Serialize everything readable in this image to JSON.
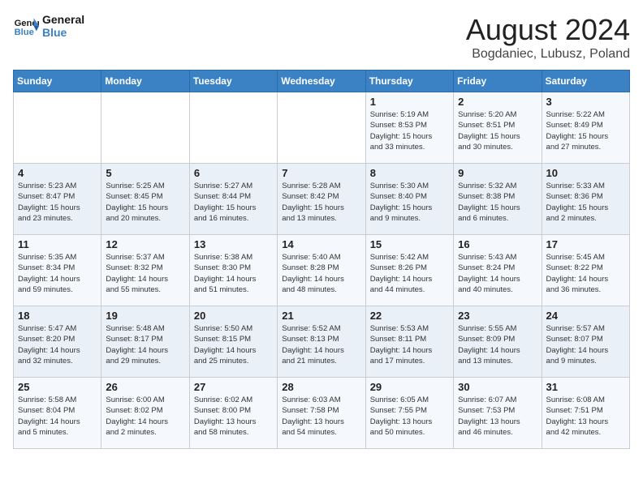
{
  "header": {
    "logo_line1": "General",
    "logo_line2": "Blue",
    "month": "August 2024",
    "location": "Bogdaniec, Lubusz, Poland"
  },
  "weekdays": [
    "Sunday",
    "Monday",
    "Tuesday",
    "Wednesday",
    "Thursday",
    "Friday",
    "Saturday"
  ],
  "weeks": [
    [
      {
        "day": "",
        "detail": ""
      },
      {
        "day": "",
        "detail": ""
      },
      {
        "day": "",
        "detail": ""
      },
      {
        "day": "",
        "detail": ""
      },
      {
        "day": "1",
        "detail": "Sunrise: 5:19 AM\nSunset: 8:53 PM\nDaylight: 15 hours\nand 33 minutes."
      },
      {
        "day": "2",
        "detail": "Sunrise: 5:20 AM\nSunset: 8:51 PM\nDaylight: 15 hours\nand 30 minutes."
      },
      {
        "day": "3",
        "detail": "Sunrise: 5:22 AM\nSunset: 8:49 PM\nDaylight: 15 hours\nand 27 minutes."
      }
    ],
    [
      {
        "day": "4",
        "detail": "Sunrise: 5:23 AM\nSunset: 8:47 PM\nDaylight: 15 hours\nand 23 minutes."
      },
      {
        "day": "5",
        "detail": "Sunrise: 5:25 AM\nSunset: 8:45 PM\nDaylight: 15 hours\nand 20 minutes."
      },
      {
        "day": "6",
        "detail": "Sunrise: 5:27 AM\nSunset: 8:44 PM\nDaylight: 15 hours\nand 16 minutes."
      },
      {
        "day": "7",
        "detail": "Sunrise: 5:28 AM\nSunset: 8:42 PM\nDaylight: 15 hours\nand 13 minutes."
      },
      {
        "day": "8",
        "detail": "Sunrise: 5:30 AM\nSunset: 8:40 PM\nDaylight: 15 hours\nand 9 minutes."
      },
      {
        "day": "9",
        "detail": "Sunrise: 5:32 AM\nSunset: 8:38 PM\nDaylight: 15 hours\nand 6 minutes."
      },
      {
        "day": "10",
        "detail": "Sunrise: 5:33 AM\nSunset: 8:36 PM\nDaylight: 15 hours\nand 2 minutes."
      }
    ],
    [
      {
        "day": "11",
        "detail": "Sunrise: 5:35 AM\nSunset: 8:34 PM\nDaylight: 14 hours\nand 59 minutes."
      },
      {
        "day": "12",
        "detail": "Sunrise: 5:37 AM\nSunset: 8:32 PM\nDaylight: 14 hours\nand 55 minutes."
      },
      {
        "day": "13",
        "detail": "Sunrise: 5:38 AM\nSunset: 8:30 PM\nDaylight: 14 hours\nand 51 minutes."
      },
      {
        "day": "14",
        "detail": "Sunrise: 5:40 AM\nSunset: 8:28 PM\nDaylight: 14 hours\nand 48 minutes."
      },
      {
        "day": "15",
        "detail": "Sunrise: 5:42 AM\nSunset: 8:26 PM\nDaylight: 14 hours\nand 44 minutes."
      },
      {
        "day": "16",
        "detail": "Sunrise: 5:43 AM\nSunset: 8:24 PM\nDaylight: 14 hours\nand 40 minutes."
      },
      {
        "day": "17",
        "detail": "Sunrise: 5:45 AM\nSunset: 8:22 PM\nDaylight: 14 hours\nand 36 minutes."
      }
    ],
    [
      {
        "day": "18",
        "detail": "Sunrise: 5:47 AM\nSunset: 8:20 PM\nDaylight: 14 hours\nand 32 minutes."
      },
      {
        "day": "19",
        "detail": "Sunrise: 5:48 AM\nSunset: 8:17 PM\nDaylight: 14 hours\nand 29 minutes."
      },
      {
        "day": "20",
        "detail": "Sunrise: 5:50 AM\nSunset: 8:15 PM\nDaylight: 14 hours\nand 25 minutes."
      },
      {
        "day": "21",
        "detail": "Sunrise: 5:52 AM\nSunset: 8:13 PM\nDaylight: 14 hours\nand 21 minutes."
      },
      {
        "day": "22",
        "detail": "Sunrise: 5:53 AM\nSunset: 8:11 PM\nDaylight: 14 hours\nand 17 minutes."
      },
      {
        "day": "23",
        "detail": "Sunrise: 5:55 AM\nSunset: 8:09 PM\nDaylight: 14 hours\nand 13 minutes."
      },
      {
        "day": "24",
        "detail": "Sunrise: 5:57 AM\nSunset: 8:07 PM\nDaylight: 14 hours\nand 9 minutes."
      }
    ],
    [
      {
        "day": "25",
        "detail": "Sunrise: 5:58 AM\nSunset: 8:04 PM\nDaylight: 14 hours\nand 5 minutes."
      },
      {
        "day": "26",
        "detail": "Sunrise: 6:00 AM\nSunset: 8:02 PM\nDaylight: 14 hours\nand 2 minutes."
      },
      {
        "day": "27",
        "detail": "Sunrise: 6:02 AM\nSunset: 8:00 PM\nDaylight: 13 hours\nand 58 minutes."
      },
      {
        "day": "28",
        "detail": "Sunrise: 6:03 AM\nSunset: 7:58 PM\nDaylight: 13 hours\nand 54 minutes."
      },
      {
        "day": "29",
        "detail": "Sunrise: 6:05 AM\nSunset: 7:55 PM\nDaylight: 13 hours\nand 50 minutes."
      },
      {
        "day": "30",
        "detail": "Sunrise: 6:07 AM\nSunset: 7:53 PM\nDaylight: 13 hours\nand 46 minutes."
      },
      {
        "day": "31",
        "detail": "Sunrise: 6:08 AM\nSunset: 7:51 PM\nDaylight: 13 hours\nand 42 minutes."
      }
    ]
  ]
}
